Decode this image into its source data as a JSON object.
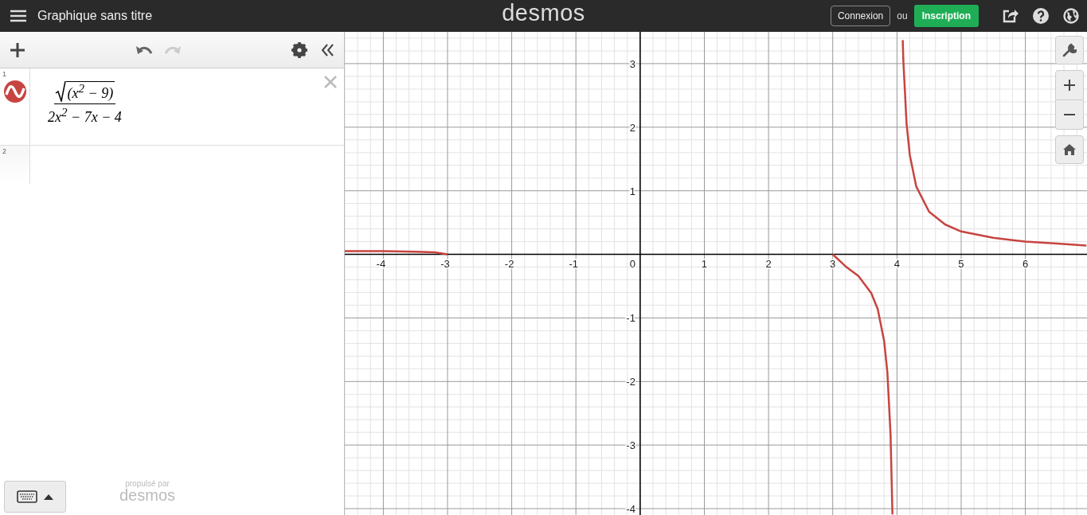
{
  "header": {
    "title": "Graphique sans titre",
    "logo": "desmos",
    "login": "Connexion",
    "or": "ou",
    "signup": "Inscription"
  },
  "toolbar": {
    "undo": {
      "disabled": false
    },
    "redo": {
      "disabled": true
    }
  },
  "expressions": [
    {
      "index": "1",
      "kind": "fraction",
      "color": "#c74440",
      "radicand": "(x$^{2}$ − 9)",
      "denominator": "2x$^{2}$ − 7x − 4"
    },
    {
      "index": "2",
      "kind": "empty"
    }
  ],
  "footer": {
    "powered_by": "propulsé par",
    "brand": "desmos"
  },
  "graph": {
    "origin_label": "0",
    "chart_data": {
      "type": "line",
      "grid": true,
      "xlim": [
        -4.6,
        6.96
      ],
      "ylim": [
        -4.1,
        3.5
      ],
      "xticks": [
        {
          "value": -4,
          "label": "-4"
        },
        {
          "value": -3,
          "label": "-3"
        },
        {
          "value": -2,
          "label": "-2"
        },
        {
          "value": -1,
          "label": "-1"
        },
        {
          "value": 1,
          "label": "1"
        },
        {
          "value": 2,
          "label": "2"
        },
        {
          "value": 3,
          "label": "3"
        },
        {
          "value": 4,
          "label": "4"
        },
        {
          "value": 5,
          "label": "5"
        },
        {
          "value": 6,
          "label": "6"
        }
      ],
      "yticks": [
        {
          "value": -4,
          "label": "-4"
        },
        {
          "value": -3,
          "label": "-3"
        },
        {
          "value": -2,
          "label": "-2"
        },
        {
          "value": -1,
          "label": "-1"
        },
        {
          "value": 1,
          "label": "1"
        },
        {
          "value": 2,
          "label": "2"
        },
        {
          "value": 3,
          "label": "3"
        }
      ],
      "x": [
        -4.6,
        -4,
        -3.5,
        -3.2,
        -3,
        null,
        3,
        3.2,
        3.4,
        3.6,
        3.7,
        3.8,
        3.85,
        3.9,
        3.93,
        null,
        4.09,
        4.1,
        4.15,
        4.2,
        4.3,
        4.5,
        4.75,
        5,
        5.5,
        6,
        6.5,
        6.95
      ],
      "series": [
        {
          "color": "#c74440",
          "values": [
            0.05,
            0.05,
            0.04,
            0.03,
            0,
            null,
            0,
            -0.19,
            -0.34,
            -0.61,
            -0.86,
            -1.36,
            -1.85,
            -2.83,
            -4.09,
            null,
            3.37,
            3.04,
            2.06,
            1.56,
            1.07,
            0.67,
            0.47,
            0.36,
            0.26,
            0.2,
            0.17,
            0.14
          ]
        }
      ]
    }
  }
}
